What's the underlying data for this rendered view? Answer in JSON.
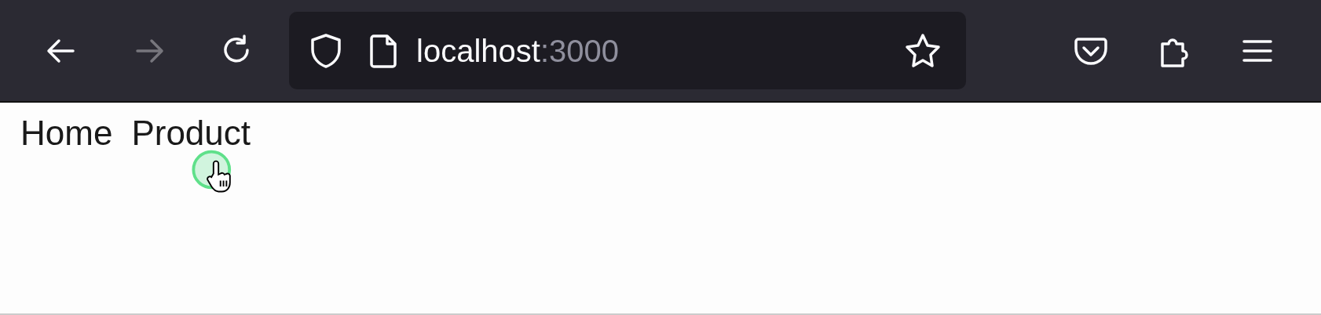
{
  "toolbar": {
    "nav_buttons": [
      {
        "kind": "back",
        "disabled": false
      },
      {
        "kind": "forward",
        "disabled": true
      },
      {
        "kind": "reload",
        "disabled": false
      }
    ],
    "address": {
      "host": "localhost",
      "port": ":3000"
    }
  },
  "page": {
    "links": [
      {
        "label": "Home"
      },
      {
        "label": "Product"
      }
    ]
  }
}
